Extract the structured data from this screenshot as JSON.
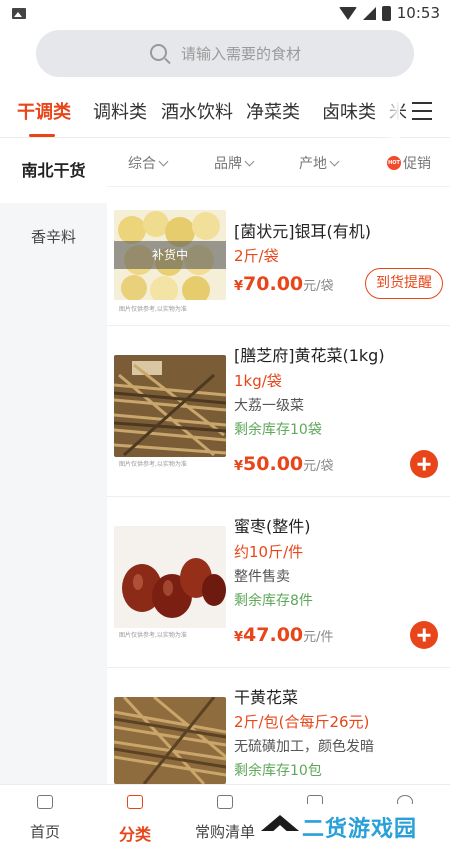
{
  "status_bar": {
    "time": "10:53"
  },
  "search": {
    "placeholder": "请输入需要的食材"
  },
  "category_tabs": [
    "干调类",
    "调料类",
    "酒水饮料",
    "净菜类",
    "卤味类",
    "米"
  ],
  "side_nav": [
    "南北干货",
    "香辛料"
  ],
  "filters": {
    "sort": "综合",
    "brand": "品牌",
    "origin": "产地",
    "promo": "促销",
    "hot_badge": "HOT"
  },
  "image_caption": "图片仅供参考,以实物为准",
  "products": [
    {
      "title": "[菌状元]银耳(有机)",
      "spec": "2斤/袋",
      "currency": "¥",
      "price": "70.00",
      "unit": "元/袋",
      "overlay": "补货中",
      "notify_label": "到货提醒",
      "image_colors": [
        "#f2e2a0",
        "#e9cf6a",
        "#fbf3cf"
      ]
    },
    {
      "title": "[膳芝府]黄花菜(1kg)",
      "spec": "1kg/袋",
      "desc": "大荔一级菜",
      "stock": "剩余库存10袋",
      "currency": "¥",
      "price": "50.00",
      "unit": "元/袋",
      "image_colors": [
        "#8a6a3c",
        "#5f4526",
        "#c7a672"
      ]
    },
    {
      "title": "蜜枣(整件)",
      "spec": "约10斤/件",
      "desc": "整件售卖",
      "stock": "剩余库存8件",
      "currency": "¥",
      "price": "47.00",
      "unit": "元/件",
      "image_colors": [
        "#7a1f12",
        "#9c3420",
        "#f4f0ea"
      ]
    },
    {
      "title": "干黄花菜",
      "spec": "2斤/包(合每斤26元)",
      "desc": "无硫磺加工，颜色发暗",
      "stock": "剩余库存10包",
      "image_colors": [
        "#a07b45",
        "#6e5430",
        "#c9a56e"
      ]
    }
  ],
  "bottom_nav": [
    "首页",
    "分类",
    "常购清单"
  ],
  "watermark": "二货游戏园",
  "colors": {
    "accent": "#e8461a",
    "stock_green": "#5ea85a"
  }
}
